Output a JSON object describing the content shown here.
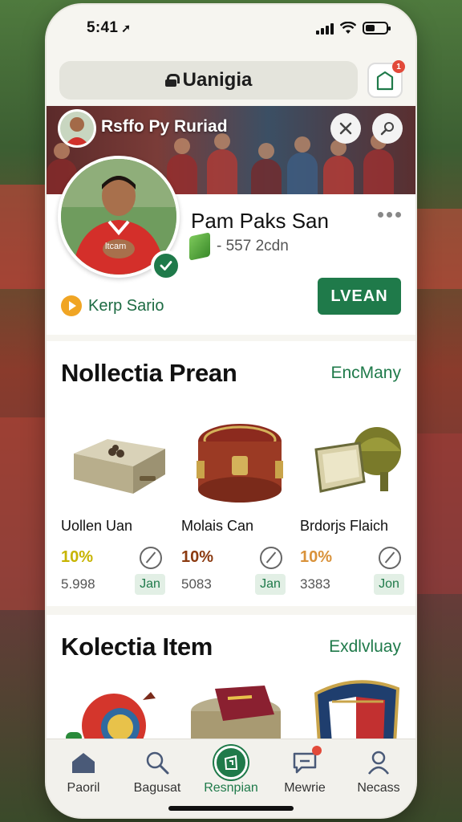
{
  "status": {
    "time": "5:41",
    "arrow": "➚"
  },
  "browser": {
    "url": "Uanigia",
    "bag_badge": "1"
  },
  "banner": {
    "name": "Rsffo Py Ruriad"
  },
  "profile": {
    "name": "Pam Paks San",
    "stat": "- 557 2cdn",
    "link": "Kerp Sario",
    "action": "LVEAN"
  },
  "section1": {
    "title": "Nollectia Prean",
    "link": "EncMany",
    "items": [
      {
        "name": "Uollen Uan",
        "pct": "10%",
        "num": "5.998",
        "btn": "Jan",
        "pct_color": "#c7b400"
      },
      {
        "name": "Molais Can",
        "pct": "10%",
        "num": "5083",
        "btn": "Jan",
        "pct_color": "#8b3a10"
      },
      {
        "name": "Brdorjs Flaich",
        "pct": "10%",
        "num": "3383",
        "btn": "Jon",
        "pct_color": "#d9923a"
      }
    ]
  },
  "section2": {
    "title": "Kolectia Item",
    "link": "Exdlvluay"
  },
  "tabs": [
    {
      "label": "Paoril",
      "icon": "home-icon"
    },
    {
      "label": "Bagusat",
      "icon": "search-icon"
    },
    {
      "label": "Resnpian",
      "icon": "bag-icon"
    },
    {
      "label": "Mewrie",
      "icon": "chat-icon"
    },
    {
      "label": "Necass",
      "icon": "profile-icon"
    }
  ],
  "colors": {
    "accent": "#1f7a4a",
    "badge": "#e24a3a"
  }
}
